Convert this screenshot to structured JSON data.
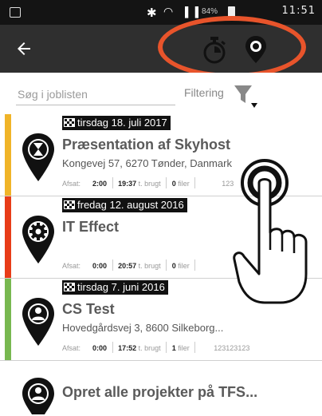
{
  "status_bar": {
    "battery_text": "84%",
    "time": "11:51"
  },
  "app_bar": {
    "back_icon": "arrow-left-icon",
    "timer_icon": "stopwatch-icon",
    "map_icon": "map-pin-icon"
  },
  "search": {
    "placeholder": "Søg i joblisten",
    "filter_label": "Filtering"
  },
  "jobs": [
    {
      "date": "tirsdag 18. juli 2017",
      "title": "Præsentation af Skyhost",
      "address": "Kongevej 57, 6270 Tønder, Danmark",
      "afsat_label": "Afsat:",
      "afsat": "2:00",
      "brugt": "19:37",
      "brugt_label": "t. brugt",
      "filer": "0",
      "filer_label": "filer",
      "ref": "123",
      "color": "#f0b428",
      "icon": "hourglass-icon"
    },
    {
      "date": "fredag 12. august 2016",
      "title": "IT Effect",
      "address": "",
      "afsat_label": "Afsat:",
      "afsat": "0:00",
      "brugt": "20:57",
      "brugt_label": "t. brugt",
      "filer": "0",
      "filer_label": "filer",
      "ref": "",
      "color": "#e83c18",
      "icon": "gear-icon"
    },
    {
      "date": "tirsdag 7. juni 2016",
      "title": "CS Test",
      "address": "Hovedgårdsvej 3, 8600 Silkeborg...",
      "afsat_label": "Afsat:",
      "afsat": "0:00",
      "brugt": "17:52",
      "brugt_label": "t. brugt",
      "filer": "1",
      "filer_label": "filer",
      "ref": "123123123",
      "color": "#78b850",
      "icon": "person-icon"
    }
  ],
  "final_item": {
    "title": "Opret alle projekter på TFS...",
    "icon": "person-icon"
  },
  "accent_color": "#e8542b"
}
